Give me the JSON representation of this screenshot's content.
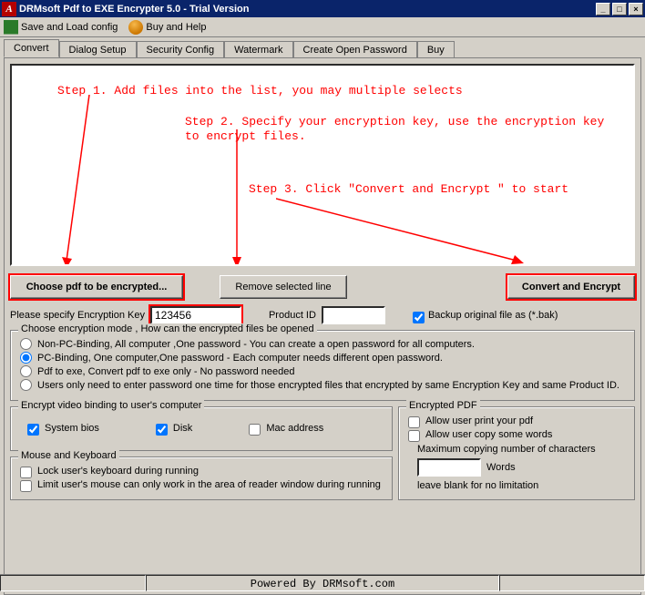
{
  "title": "DRMsoft Pdf to EXE Encrypter 5.0 - Trial Version",
  "menu": {
    "save": "Save and Load config",
    "buy": "Buy and Help"
  },
  "tabs": [
    "Convert",
    "Dialog Setup",
    "Security Config",
    "Watermark",
    "Create Open Password",
    "Buy"
  ],
  "anno": {
    "step1": "Step 1. Add files into the list, you may multiple selects",
    "step2a": "Step 2. Specify your encryption key, use the encryption key",
    "step2b": "to encrypt files.",
    "step3": "Step 3. Click \"Convert and Encrypt \" to start"
  },
  "buttons": {
    "choose": "Choose pdf to be encrypted...",
    "remove": "Remove selected line",
    "convert": "Convert and Encrypt"
  },
  "keyrow": {
    "label": "Please specify Encryption Key",
    "value": "123456",
    "pid_label": "Product ID",
    "pid_value": "",
    "backup": "Backup original file as (*.bak)"
  },
  "modes": {
    "legend": "Choose encryption mode , How can the encrypted files be opened",
    "opt1": "Non-PC-Binding, All computer ,One password  - You can create a open password for all computers.",
    "opt2": "PC-Binding, One computer,One password  - Each computer needs different open password.",
    "opt3": "Pdf to exe, Convert pdf to exe only - No password needed",
    "opt4": "Users only need to enter password one time for those encrypted files that encrypted by same Encryption Key and same Product ID."
  },
  "bind": {
    "legend": "Encrypt video binding to user's computer",
    "bios": "System bios",
    "disk": "Disk",
    "mac": "Mac address"
  },
  "mouse": {
    "legend": "Mouse and Keyboard",
    "lock": "Lock user's keyboard during running",
    "limit": "Limit user's mouse can only work in the area of reader window during running"
  },
  "pdf": {
    "legend": "Encrypted PDF",
    "print": "Allow user print your pdf",
    "copy": "Allow user copy some words",
    "maxlabel": "Maximum copying number of characters",
    "maxval": "",
    "words": "Words",
    "leave": "leave blank for no limitation"
  },
  "status": "Powered By DRMsoft.com"
}
